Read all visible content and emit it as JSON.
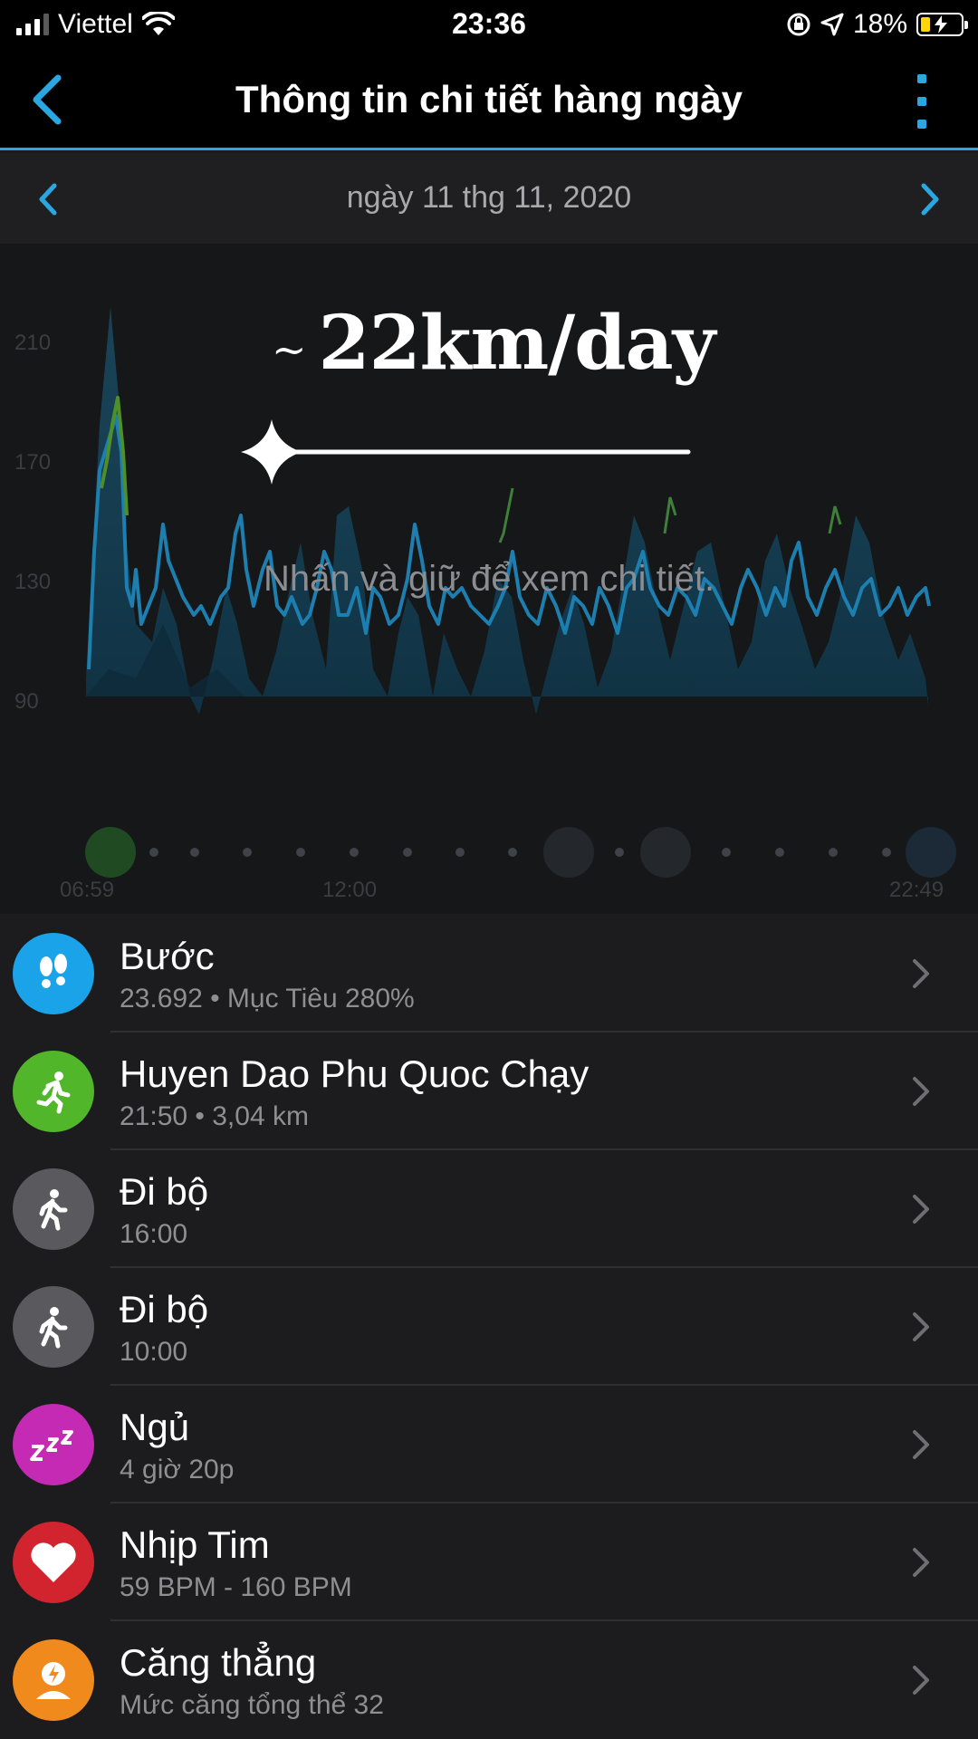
{
  "status_bar": {
    "carrier": "Viettel",
    "time": "23:36",
    "battery": "18%"
  },
  "nav": {
    "title": "Thông tin chi tiết hàng ngày"
  },
  "date_row": {
    "date": "ngày 11 thg 11, 2020"
  },
  "chart": {
    "y_labels": [
      "210",
      "170",
      "130",
      "90"
    ],
    "x_labels": [
      "06:59",
      "12:00",
      "22:49"
    ],
    "overlay_tilde": "~",
    "overlay_title": "22km/day",
    "hint": "Nhấn và giữ để xem chi tiết."
  },
  "items": [
    {
      "title": "Bước",
      "sub": "23.692 • Mục Tiêu 280%",
      "icon": "footsteps-icon",
      "color": "#1aa3e8"
    },
    {
      "title": "Huyen Dao Phu Quoc Chạy",
      "sub": "21:50 • 3,04 km",
      "icon": "running-icon",
      "color": "#52b62a"
    },
    {
      "title": "Đi bộ",
      "sub": "16:00",
      "icon": "walking-icon",
      "color": "#5a5a5e"
    },
    {
      "title": "Đi bộ",
      "sub": "10:00",
      "icon": "walking-icon",
      "color": "#5a5a5e"
    },
    {
      "title": "Ngủ",
      "sub": "4 giờ 20p",
      "icon": "sleep-icon",
      "color": "#c42ab4"
    },
    {
      "title": "Nhịp Tim",
      "sub": "59 BPM - 160 BPM",
      "icon": "heart-icon",
      "color": "#d1242f"
    },
    {
      "title": "Căng thẳng",
      "sub": "Mức căng tổng thể 32",
      "icon": "stress-icon",
      "color": "#f08a1c"
    }
  ]
}
